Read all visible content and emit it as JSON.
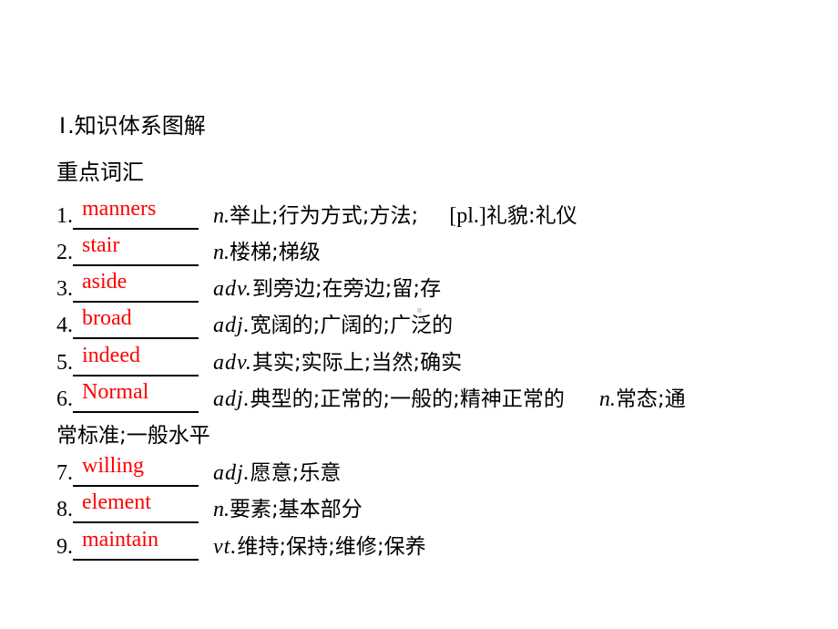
{
  "section": {
    "numeral": "Ⅰ",
    "title": ".知识体系图解"
  },
  "subsection": {
    "title": "重点词汇"
  },
  "colors": {
    "answer": "#ff0000",
    "text": "#000000"
  },
  "vocab": [
    {
      "num": "1.",
      "answer": "manners",
      "pos": "n.",
      "def": "举止;行为方式;方法;",
      "extra_label": "[pl.]",
      "extra_def": "礼貌:礼仪"
    },
    {
      "num": "2.",
      "answer": "stair",
      "pos": "n.",
      "def": "楼梯;梯级"
    },
    {
      "num": "3.",
      "answer": "aside",
      "pos": "adv.",
      "def": "到旁边;在旁边;留;存"
    },
    {
      "num": "4.",
      "answer": "broad",
      "pos": "adj.",
      "def": "宽阔的;广阔的;广泛的"
    },
    {
      "num": "5.",
      "answer": "indeed",
      "pos": "adv.",
      "def": "其实;实际上;当然;确实"
    },
    {
      "num": "6.",
      "answer": "Normal",
      "pos": "adj.",
      "def": "典型的;正常的;一般的;精神正常的",
      "pos2": "n.",
      "def2": "常态;通",
      "def2_cont": "常标准;一般水平"
    },
    {
      "num": "7.",
      "answer": "willing",
      "pos": "adj.",
      "def": "愿意;乐意"
    },
    {
      "num": "8.",
      "answer": "element",
      "pos": "n.",
      "def": "要素;基本部分"
    },
    {
      "num": "9.",
      "answer": "maintain",
      "pos": "vt.",
      "def": "维持;保持;维修;保养"
    }
  ]
}
